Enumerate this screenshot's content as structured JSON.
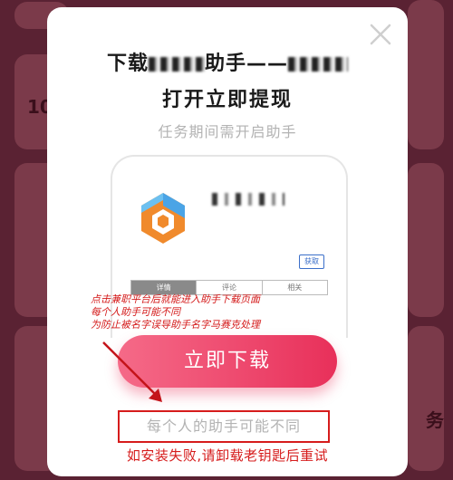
{
  "background": {
    "number_label": "10",
    "char_label": "务"
  },
  "modal": {
    "title_prefix": "下载",
    "title_middle": "助手——",
    "title_line2": "打开立即提现",
    "subtitle": "任务期间需开启助手",
    "phone": {
      "get_label": "获取",
      "tabs": [
        "详情",
        "评论",
        "相关"
      ]
    },
    "note_lines": [
      "点击兼职平台后就能进入助手下载页面",
      "每个人助手可能不同",
      "为防止被名字误导助手名字马赛克处理"
    ],
    "download_label": "立即下载",
    "differs_label": "每个人的助手可能不同",
    "install_fail_label": "如安装失败,请卸载老钥匙后重试"
  },
  "colors": {
    "accent": "#e8305a",
    "annotation_red": "#d61c1c",
    "overlay": "#5a2233"
  },
  "icons": {
    "close": "close-icon",
    "app_logo": "hexagon-logo-icon"
  }
}
